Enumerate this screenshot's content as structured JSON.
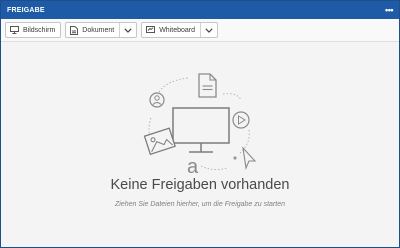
{
  "window": {
    "title": "FREIGABE",
    "menu_label": "•••"
  },
  "toolbar": {
    "screen_label": "Bildschirm",
    "document_label": "Dokument",
    "whiteboard_label": "Whiteboard"
  },
  "empty_state": {
    "heading": "Keine Freigaben vorhanden",
    "subtext": "Ziehen Sie Dateien hierher, um die Freigabe zu starten"
  },
  "icons": [
    "monitor-icon",
    "chevron-down-icon",
    "whiteboard-icon",
    "document-icon",
    "user-icon",
    "image-icon",
    "play-icon",
    "cursor-icon",
    "text-icon"
  ]
}
